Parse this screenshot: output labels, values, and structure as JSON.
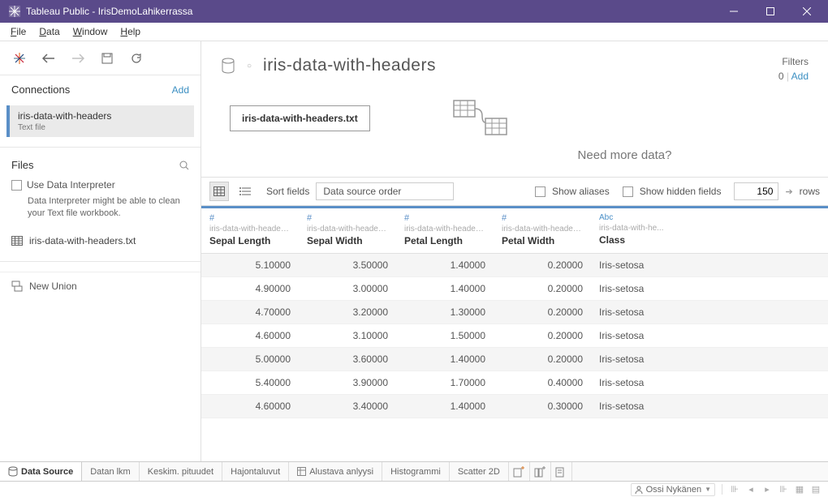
{
  "window": {
    "title": "Tableau Public - IrisDemoLahikerrassa"
  },
  "menu": [
    "File",
    "Data",
    "Window",
    "Help"
  ],
  "sidebar": {
    "connections_label": "Connections",
    "add_label": "Add",
    "connection": {
      "name": "iris-data-with-headers",
      "type": "Text file"
    },
    "files_label": "Files",
    "use_interpreter": "Use Data Interpreter",
    "interpreter_note": "Data Interpreter might be able to clean your Text file workbook.",
    "file_name": "iris-data-with-headers.txt",
    "new_union": "New Union"
  },
  "datasource": {
    "title": "iris-data-with-headers",
    "filters_label": "Filters",
    "filters_count": "0",
    "add_label": "Add",
    "table_chip": "iris-data-with-headers.txt",
    "need_more": "Need more data?"
  },
  "grid_toolbar": {
    "sort_label": "Sort fields",
    "sort_value": "Data source order",
    "show_aliases": "Show aliases",
    "show_hidden": "Show hidden fields",
    "rows_value": "150",
    "rows_label": "rows"
  },
  "columns": [
    {
      "type": "#",
      "source": "iris-data-with-headers.txt",
      "name": "Sepal Length"
    },
    {
      "type": "#",
      "source": "iris-data-with-headers...",
      "name": "Sepal Width"
    },
    {
      "type": "#",
      "source": "iris-data-with-headers.txt",
      "name": "Petal Length"
    },
    {
      "type": "#",
      "source": "iris-data-with-headers...",
      "name": "Petal Width"
    },
    {
      "type": "Abc",
      "source": "iris-data-with-he...",
      "name": "Class"
    }
  ],
  "rows": [
    [
      "5.10000",
      "3.50000",
      "1.40000",
      "0.20000",
      "Iris-setosa"
    ],
    [
      "4.90000",
      "3.00000",
      "1.40000",
      "0.20000",
      "Iris-setosa"
    ],
    [
      "4.70000",
      "3.20000",
      "1.30000",
      "0.20000",
      "Iris-setosa"
    ],
    [
      "4.60000",
      "3.10000",
      "1.50000",
      "0.20000",
      "Iris-setosa"
    ],
    [
      "5.00000",
      "3.60000",
      "1.40000",
      "0.20000",
      "Iris-setosa"
    ],
    [
      "5.40000",
      "3.90000",
      "1.70000",
      "0.40000",
      "Iris-setosa"
    ],
    [
      "4.60000",
      "3.40000",
      "1.40000",
      "0.30000",
      "Iris-setosa"
    ]
  ],
  "tabs": {
    "data_source": "Data Source",
    "items": [
      "Datan lkm",
      "Keskim. pituudet",
      "Hajontaluvut",
      "Alustava anlyysi",
      "Histogrammi",
      "Scatter 2D"
    ]
  },
  "status": {
    "user": "Ossi Nykänen"
  }
}
